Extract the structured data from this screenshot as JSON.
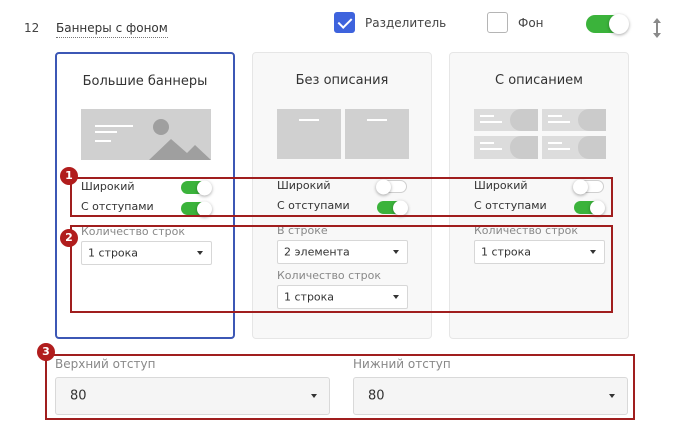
{
  "header": {
    "row_number": "12",
    "section_title": "Баннеры с фоном",
    "divider_label": "Разделитель",
    "background_label": "Фон"
  },
  "cards": [
    {
      "title": "Большие баннеры",
      "wide_label": "Широкий",
      "padding_label": "С отступами",
      "rows_label": "Количество строк",
      "rows_value": "1 строка"
    },
    {
      "title": "Без описания",
      "wide_label": "Широкий",
      "padding_label": "С отступами",
      "per_row_label": "В строке",
      "per_row_value": "2 элемента",
      "rows_label": "Количество строк",
      "rows_value": "1 строка"
    },
    {
      "title": "С описанием",
      "wide_label": "Широкий",
      "padding_label": "С отступами",
      "rows_label": "Количество строк",
      "rows_value": "1 строка"
    }
  ],
  "spacing": {
    "top_label": "Верхний отступ",
    "top_value": "80",
    "bottom_label": "Нижний отступ",
    "bottom_value": "80"
  },
  "annotations": [
    "1",
    "2",
    "3"
  ],
  "colors": {
    "accent": "#3e63dd",
    "toggle_on": "#3bb33b",
    "selected_border": "#3c57b5",
    "annotation": "#a01e1e"
  },
  "states": {
    "divider_checked": true,
    "background_checked": false,
    "main_toggle_on": true,
    "card1_wide_on": true,
    "card1_padding_on": true,
    "card2_wide_on": false,
    "card2_padding_on": true,
    "card3_wide_on": false,
    "card3_padding_on": true,
    "selected_card": "Большие баннеры"
  }
}
